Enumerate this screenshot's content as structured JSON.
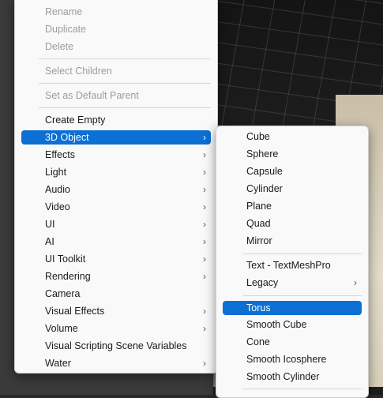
{
  "main_menu": {
    "disabled_items": [
      "Rename",
      "Duplicate",
      "Delete",
      "Select Children",
      "Set as Default Parent"
    ],
    "items": [
      {
        "label": "Create Empty",
        "arrow": false
      },
      {
        "label": "3D Object",
        "arrow": true,
        "highlighted": true
      },
      {
        "label": "Effects",
        "arrow": true
      },
      {
        "label": "Light",
        "arrow": true
      },
      {
        "label": "Audio",
        "arrow": true
      },
      {
        "label": "Video",
        "arrow": true
      },
      {
        "label": "UI",
        "arrow": true
      },
      {
        "label": "AI",
        "arrow": true
      },
      {
        "label": "UI Toolkit",
        "arrow": true
      },
      {
        "label": "Rendering",
        "arrow": true
      },
      {
        "label": "Camera",
        "arrow": false
      },
      {
        "label": "Visual Effects",
        "arrow": true
      },
      {
        "label": "Volume",
        "arrow": true
      },
      {
        "label": "Visual Scripting Scene Variables",
        "arrow": false
      },
      {
        "label": "Water",
        "arrow": true
      }
    ]
  },
  "submenu_3d_object": {
    "items": [
      {
        "label": "Cube"
      },
      {
        "label": "Sphere"
      },
      {
        "label": "Capsule"
      },
      {
        "label": "Cylinder"
      },
      {
        "label": "Plane"
      },
      {
        "label": "Quad"
      },
      {
        "label": "Mirror"
      },
      {
        "label": "Text - TextMeshPro"
      },
      {
        "label": "Legacy",
        "arrow": true
      },
      {
        "label": "Torus",
        "highlighted": true
      },
      {
        "label": "Smooth Cube"
      },
      {
        "label": "Cone"
      },
      {
        "label": "Smooth Icosphere"
      },
      {
        "label": "Smooth Cylinder"
      }
    ]
  },
  "icons": {
    "submenu_arrow": "›"
  },
  "colors": {
    "highlight": "#0b6fd3",
    "menu_bg": "#f9f9f9",
    "disabled_text": "#9c9c9c"
  }
}
